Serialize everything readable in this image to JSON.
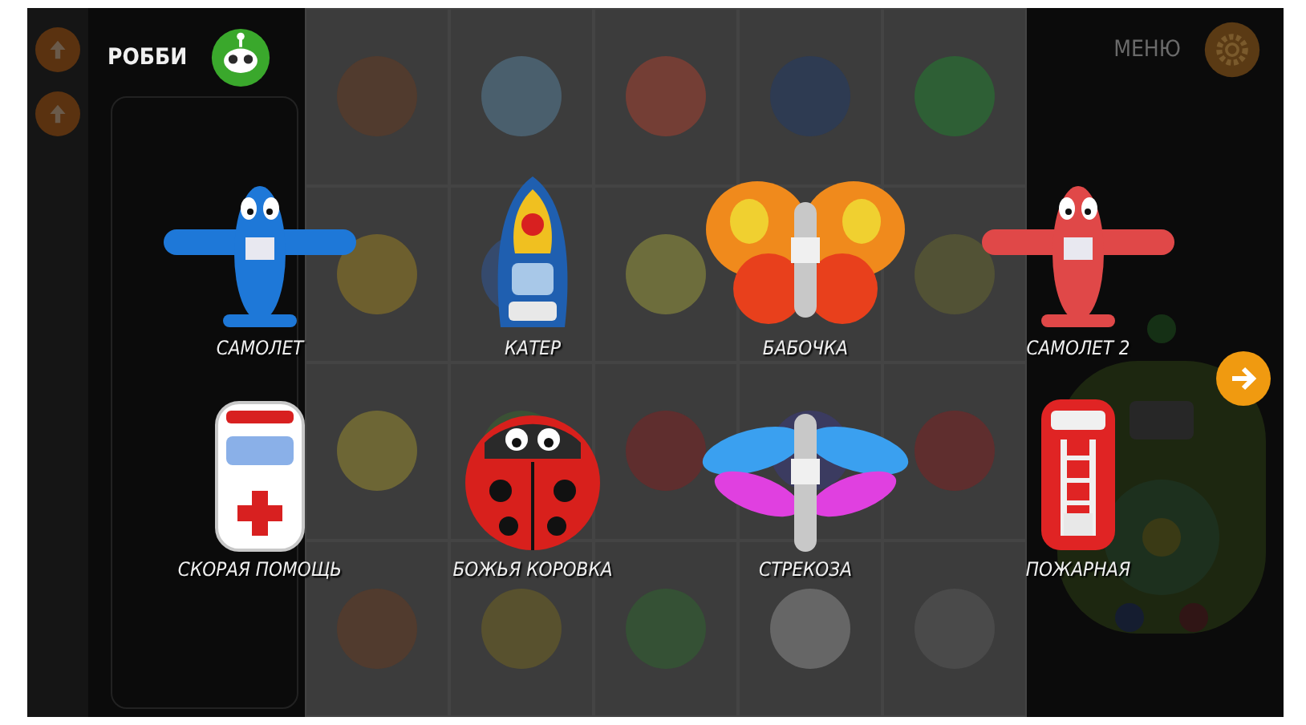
{
  "header": {
    "title": "РОББИ",
    "menu": "МЕНЮ"
  },
  "characters": [
    {
      "label": "САМОЛЕТ",
      "kind": "plane",
      "color": "#1e78d8"
    },
    {
      "label": "КАТЕР",
      "kind": "boat",
      "color": "#1f5fb0"
    },
    {
      "label": "БАБОЧКА",
      "kind": "butterfly",
      "color": "#f08a1c"
    },
    {
      "label": "САМОЛЕТ 2",
      "kind": "plane",
      "color": "#e04848"
    },
    {
      "label": "СКОРАЯ ПОМОЩЬ",
      "kind": "ambulance",
      "color": "#ffffff"
    },
    {
      "label": "БОЖЬЯ КОРОВКА",
      "kind": "ladybug",
      "color": "#d8201c"
    },
    {
      "label": "СТРЕКОЗА",
      "kind": "dragonfly",
      "color": "#3aa0f0"
    },
    {
      "label": "ПОЖАРНАЯ",
      "kind": "firetruck",
      "color": "#e02424"
    }
  ]
}
